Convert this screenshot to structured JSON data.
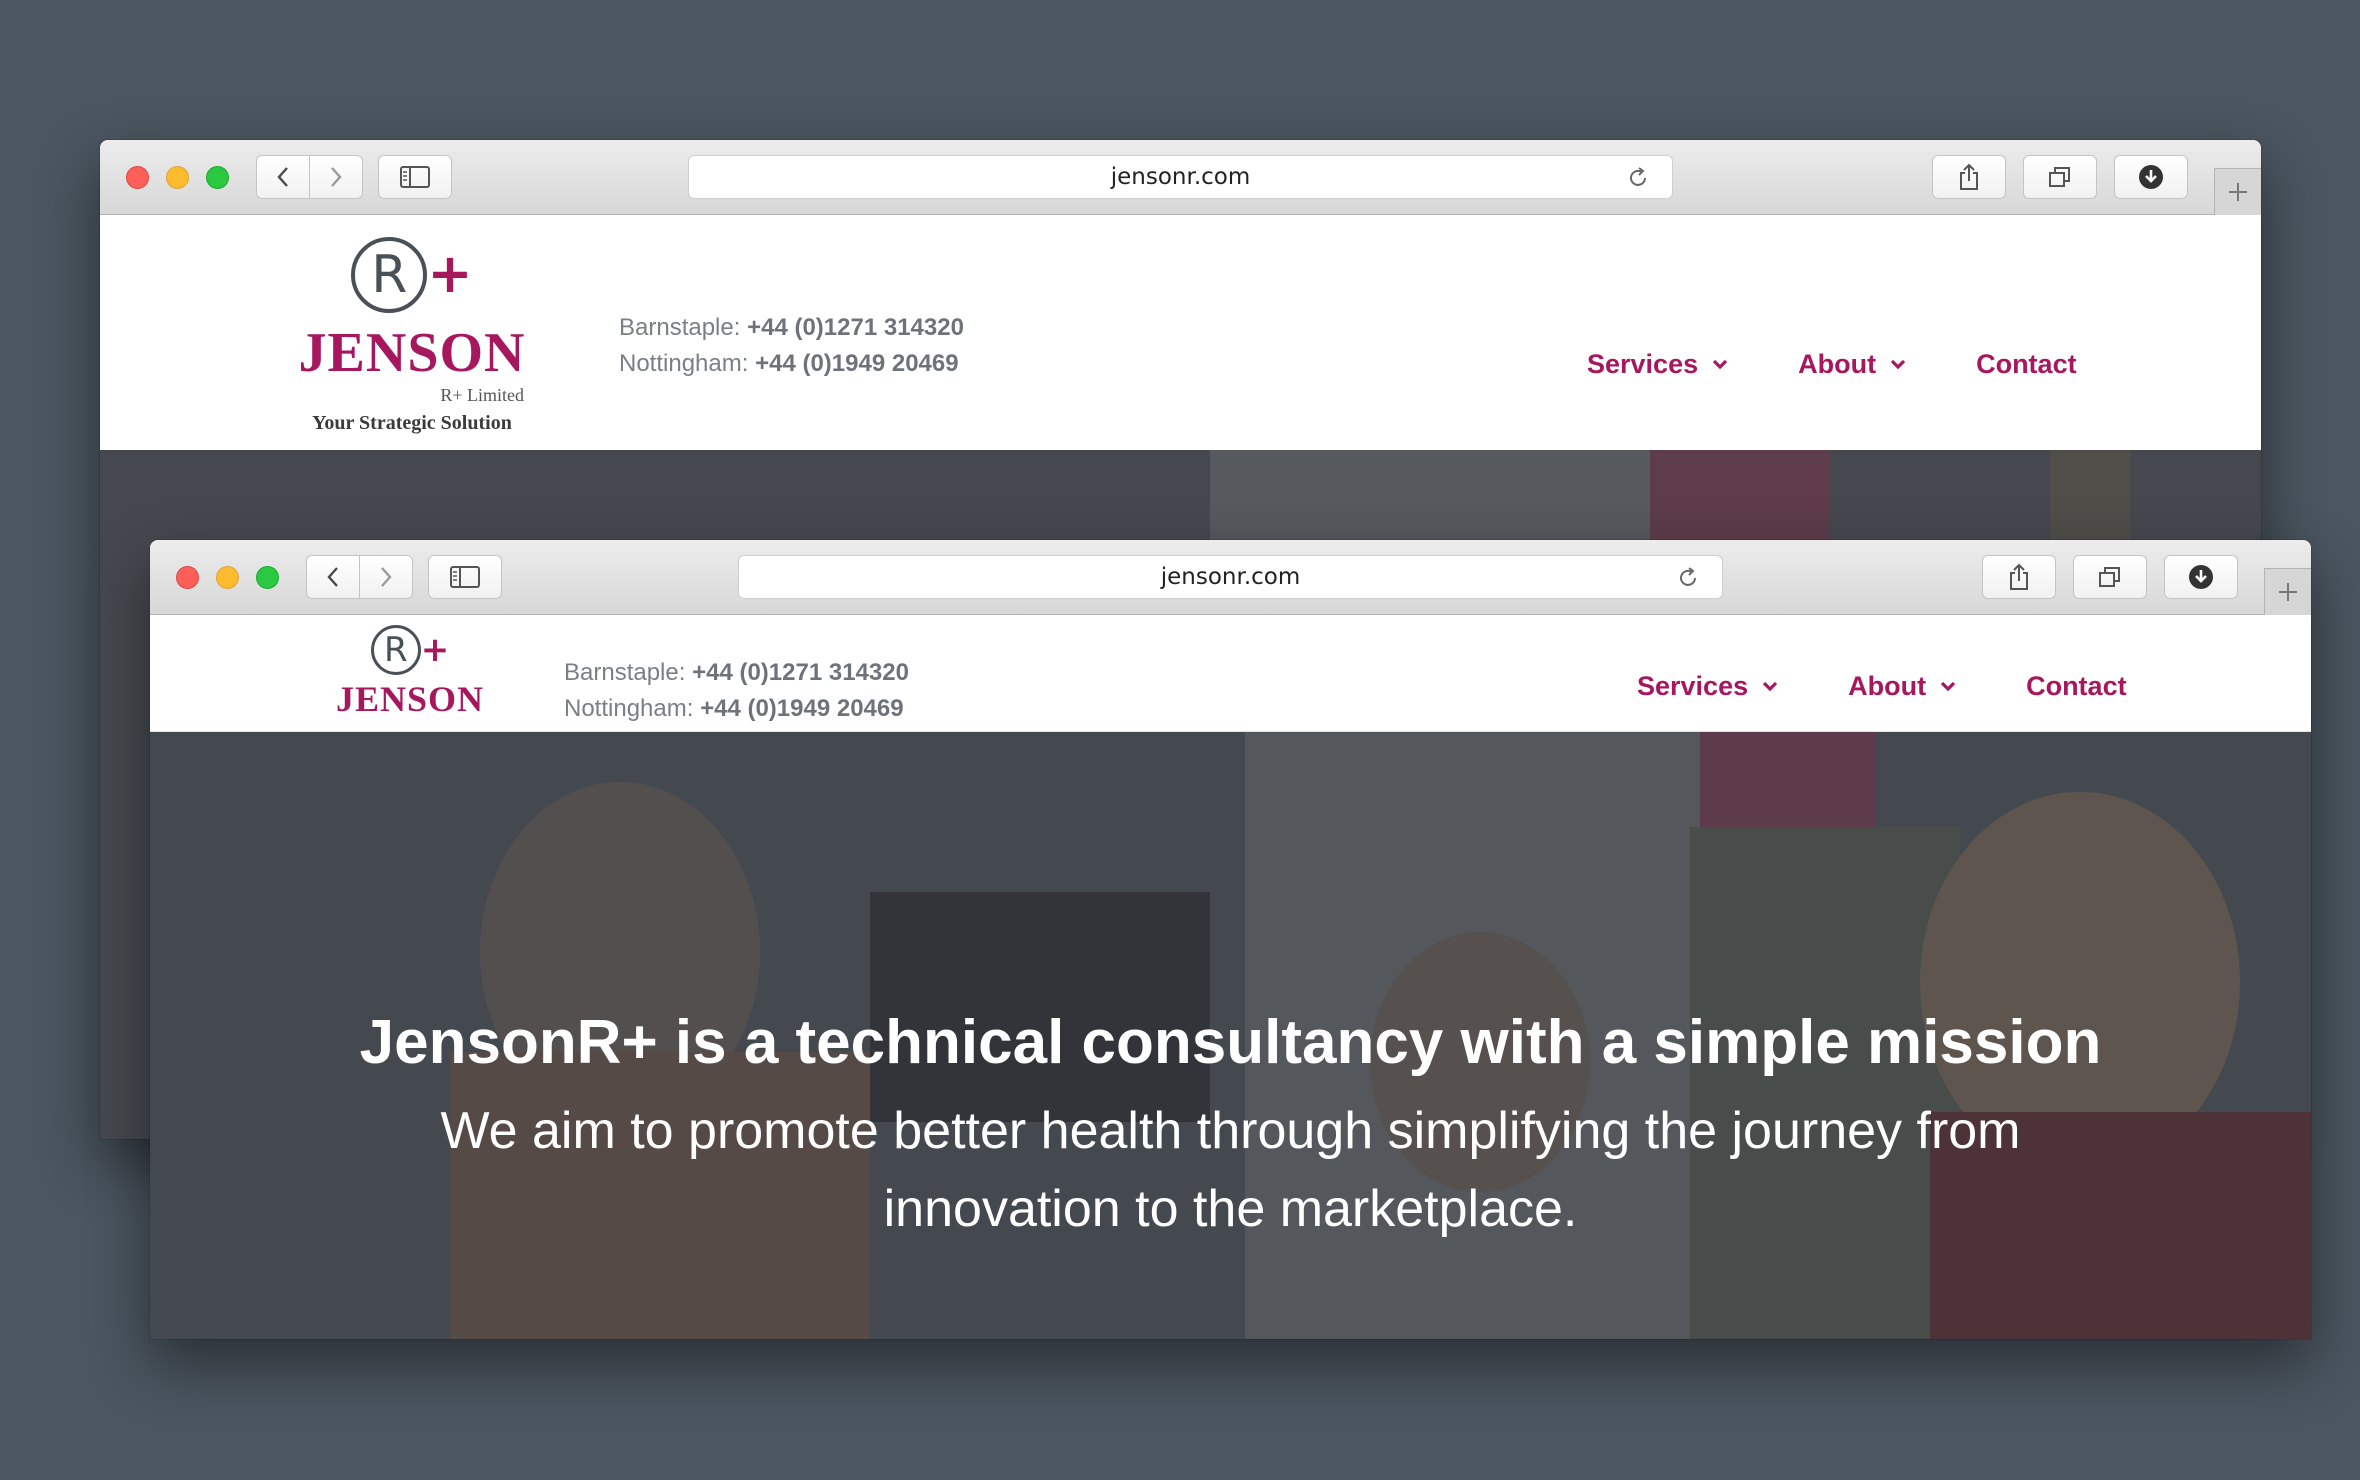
{
  "browser": {
    "url": "jensonr.com"
  },
  "site": {
    "logo": {
      "wordmark": "JENSON",
      "mark_letter": "R",
      "mark_plus": "+",
      "sub": "R+ Limited",
      "tagline": "Your Strategic Solution"
    },
    "contacts": [
      {
        "label": "Barnstaple:",
        "phone": "+44 (0)1271 314320"
      },
      {
        "label": "Nottingham:",
        "phone": "+44 (0)1949 20469"
      }
    ],
    "nav": [
      {
        "label": "Services",
        "dropdown": true
      },
      {
        "label": "About",
        "dropdown": true
      },
      {
        "label": "Contact",
        "dropdown": false
      }
    ],
    "hero": {
      "title": "JensonR+ is a technical consultancy with a simple mission",
      "subtitle": "We aim to promote better health through simplifying the journey from innovation to the marketplace."
    }
  },
  "colors": {
    "brand": "#a6175e",
    "desktop": "#4b5660",
    "contact_text": "#7a7f86"
  },
  "icons": [
    "back-chevron",
    "forward-chevron",
    "sidebar",
    "reload",
    "share",
    "tabs",
    "download",
    "new-tab-plus",
    "dropdown-chevron"
  ]
}
